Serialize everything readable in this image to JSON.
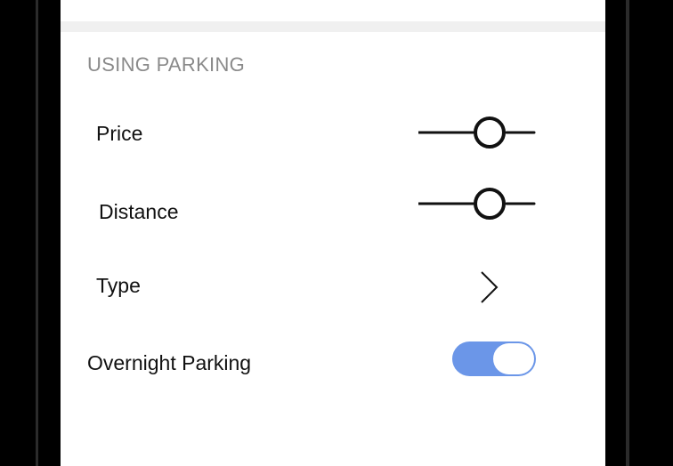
{
  "section": {
    "title": "USING PARKING"
  },
  "rows": {
    "price": {
      "label": "Price"
    },
    "distance": {
      "label": "Distance"
    },
    "type": {
      "label": "Type"
    },
    "overnight": {
      "label": "Overnight Parking",
      "enabled": true
    }
  },
  "icons": {
    "price_slider": "slider-icon",
    "distance_slider": "slider-icon",
    "type_chevron": "chevron-right-icon"
  },
  "colors": {
    "toggle_on": "#6b96e8",
    "header_text": "#8a8a8a",
    "divider_band": "#f0f0f0"
  }
}
